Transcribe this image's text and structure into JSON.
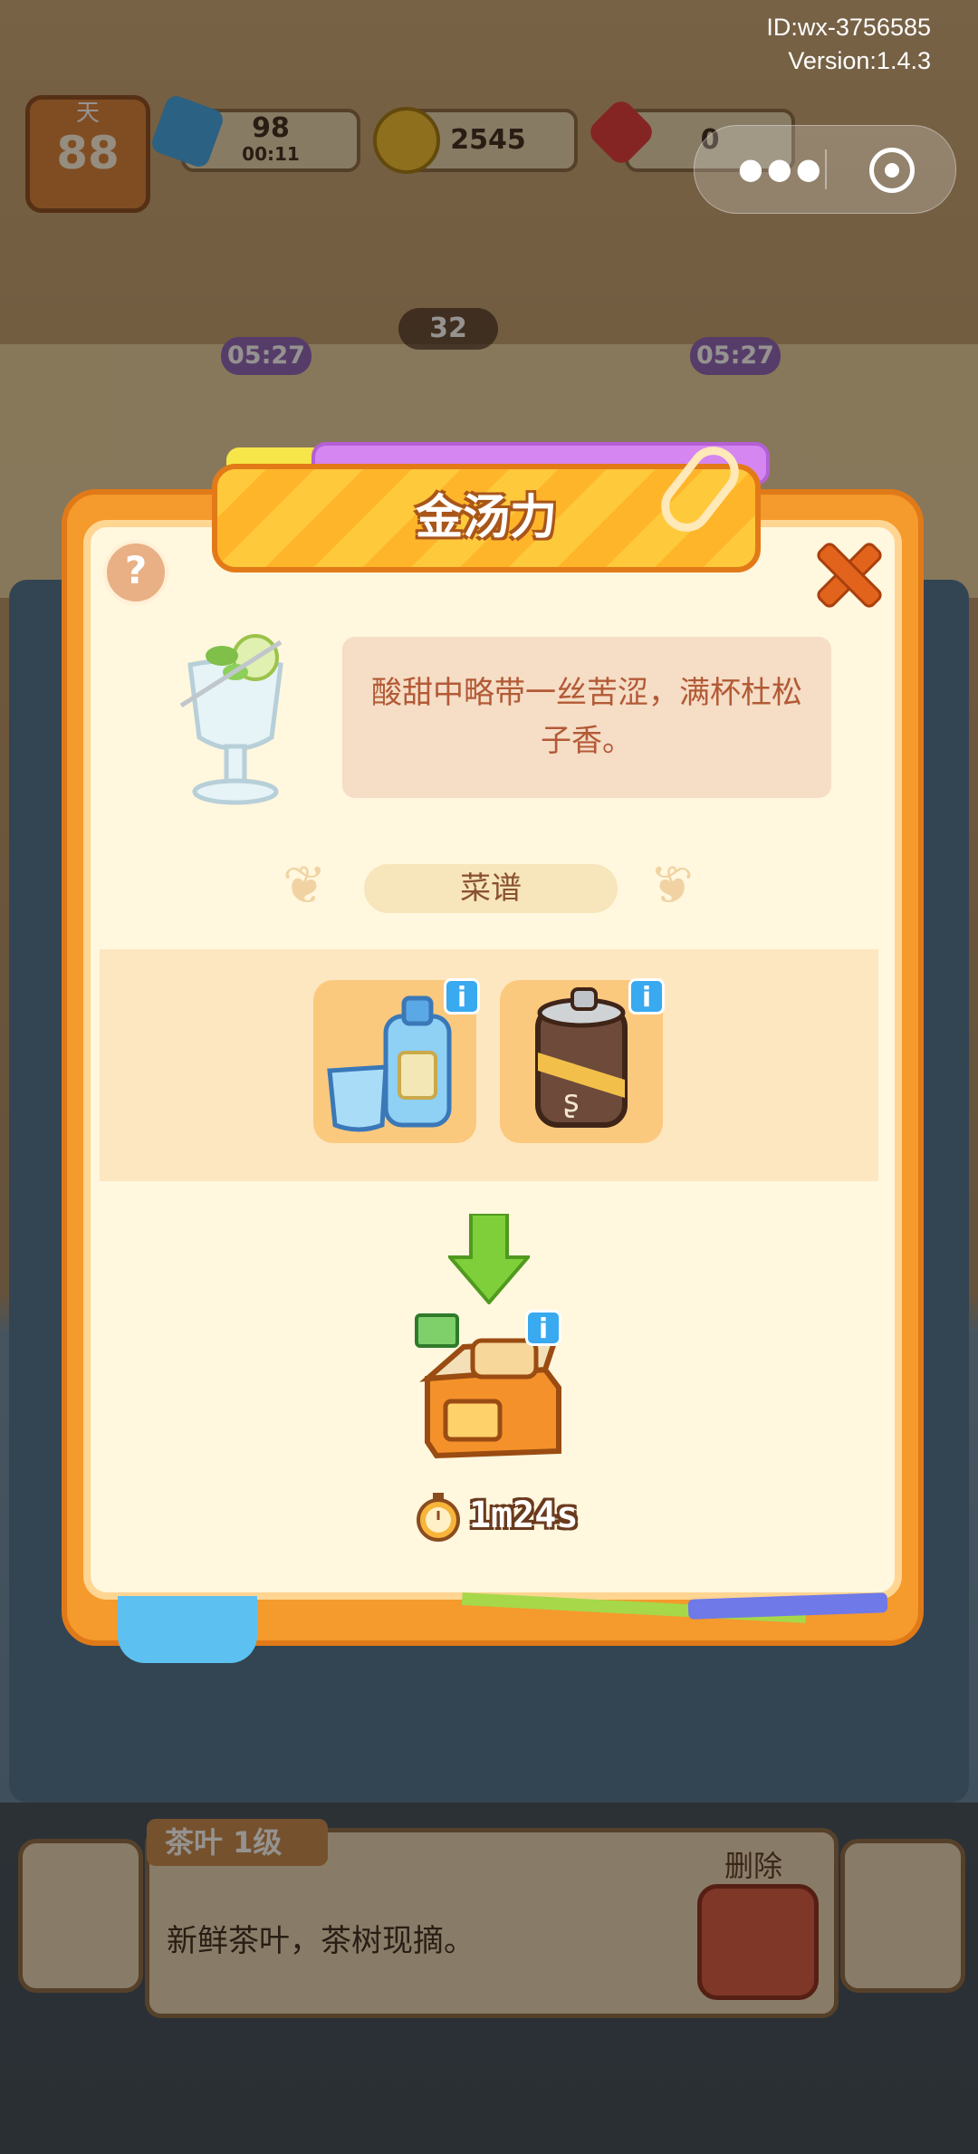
{
  "system": {
    "id_text": "ID:wx-3756585",
    "version_text": "Version:1.4.3",
    "capsule_dots": "•●•"
  },
  "hud": {
    "day_label": "天",
    "day_value": "88",
    "energy_value": "98",
    "energy_timer": "00:11",
    "coins_value": "2545",
    "gems_value": "0",
    "order_timer_left": "05:27",
    "order_timer_right": "05:27",
    "center_count": "32"
  },
  "modal": {
    "title": "金汤力",
    "description": "酸甜中略带一丝苦涩，满杯杜松子香。",
    "recipe_label": "菜谱",
    "help_symbol": "?",
    "info_symbol": "i",
    "ingredients": [
      {
        "name": "gin-bottle-icon"
      },
      {
        "name": "tonic-can-icon"
      }
    ],
    "cook_time": "1m24s"
  },
  "bottom": {
    "item_tag": "茶叶 1级",
    "item_desc": "新鲜茶叶，茶树现摘。",
    "delete_label": "删除"
  },
  "colors": {
    "modal_orange": "#f59a2c",
    "title_yellow": "#ffc93c",
    "info_blue": "#39a9f0",
    "speech_text": "#b35a36"
  }
}
